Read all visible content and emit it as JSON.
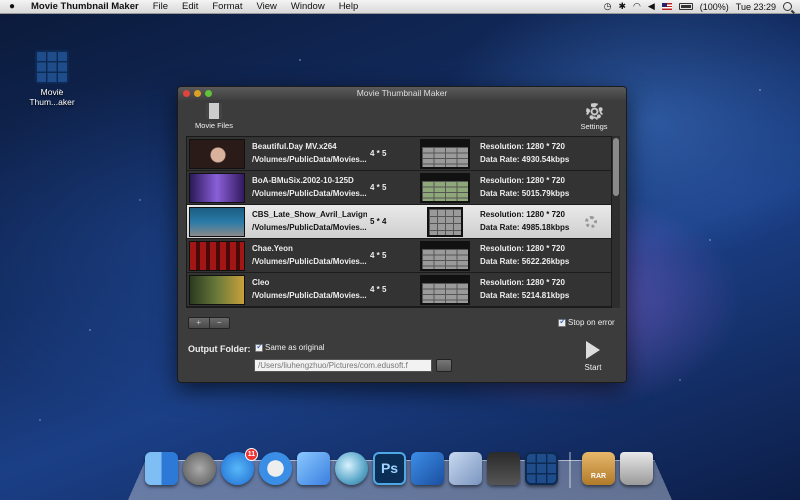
{
  "menubar": {
    "app_name": "Movie Thumbnail Maker",
    "items": [
      "File",
      "Edit",
      "Format",
      "View",
      "Window",
      "Help"
    ],
    "battery_text": "(100%)",
    "clock": "Tue 23:29"
  },
  "desktop": {
    "icon_label_line1": "Movie",
    "icon_label_line2": "Thum...aker"
  },
  "window": {
    "title": "Movie Thumbnail Maker",
    "toolbar": {
      "movie_files_label": "Movie Files",
      "settings_label": "Settings"
    },
    "rows": [
      {
        "name": "Beautiful.Day MV.x264",
        "path": "/Volumes/PublicData/Movies...",
        "grid": "4 * 5",
        "resolution": "Resolution: 1280 * 720",
        "rate": "Data Rate: 4930.54kbps"
      },
      {
        "name": "BoA-BMuSix.2002-10-125D",
        "path": "/Volumes/PublicData/Movies...",
        "grid": "4 * 5",
        "resolution": "Resolution: 1280 * 720",
        "rate": "Data Rate: 5015.79kbps"
      },
      {
        "name": "CBS_Late_Show_Avril_Lavigne...",
        "path": "/Volumes/PublicData/Movies...",
        "grid": "5 * 4",
        "resolution": "Resolution: 1280 * 720",
        "rate": "Data Rate: 4985.18kbps"
      },
      {
        "name": "Chae.Yeon",
        "path": "/Volumes/PublicData/Movies...",
        "grid": "4 * 5",
        "resolution": "Resolution: 1280 * 720",
        "rate": "Data Rate: 5622.26kbps"
      },
      {
        "name": "Cleo",
        "path": "/Volumes/PublicData/Movies...",
        "grid": "4 * 5",
        "resolution": "Resolution: 1280 * 720",
        "rate": "Data Rate: 5214.81kbps"
      }
    ],
    "add_label": "+",
    "remove_label": "−",
    "stop_on_error_label": "Stop on error",
    "output_folder_label": "Output Folder:",
    "same_as_original_label": "Same as original",
    "output_path_value": "/Users/liuhengzhuo/Pictures/com.edusoft.f",
    "start_label": "Start"
  },
  "dock": {
    "appstore_badge": "11",
    "ps_label": "Ps",
    "rar_label": "RAR"
  }
}
